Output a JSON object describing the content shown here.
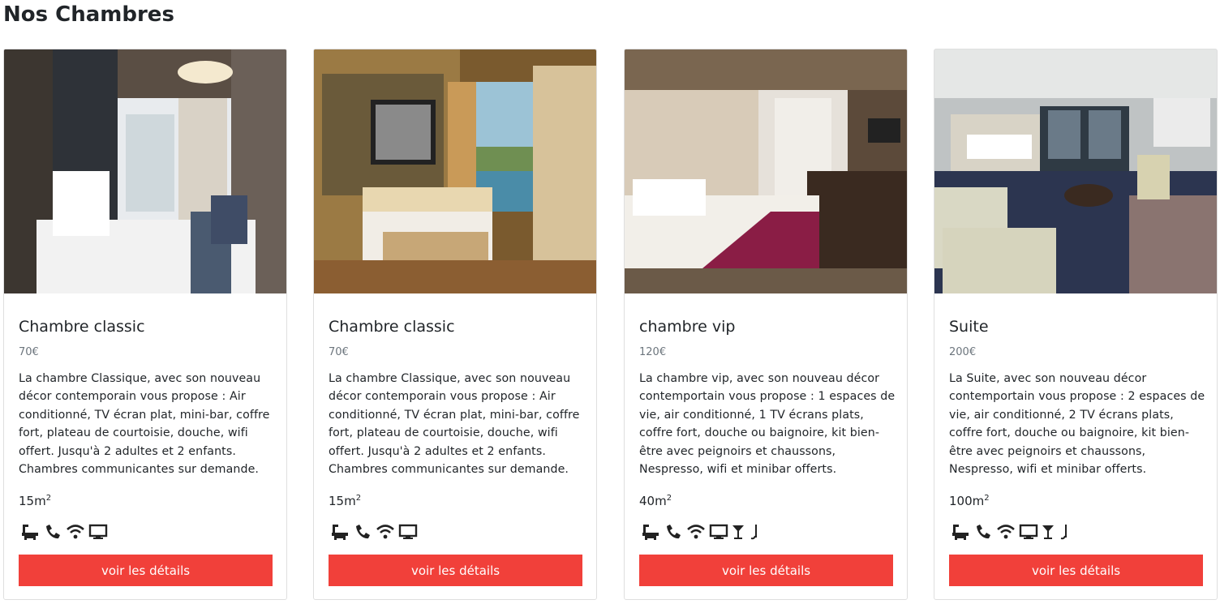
{
  "page_title": "Nos Chambres",
  "colors": {
    "button": "#f1403a",
    "price": "#6c757d",
    "text": "#212529"
  },
  "rooms": [
    {
      "title": "Chambre classic",
      "price": "70€",
      "description": "La chambre Classique, avec son nouveau décor contemporain vous propose : Air conditionné, TV écran plat, mini-bar, coffre fort, plateau de courtoisie, douche, wifi offert. Jusqu'à 2 adultes et 2 enfants. Chambres communicantes sur demande.",
      "area_value": "15m",
      "area_exp": "2",
      "amenities": [
        "bathtub-icon",
        "phone-icon",
        "wifi-icon",
        "tv-icon"
      ],
      "button": "voir les détails"
    },
    {
      "title": "Chambre classic",
      "price": "70€",
      "description": "La chambre Classique, avec son nouveau décor contemporain vous propose : Air conditionné, TV écran plat, mini-bar, coffre fort, plateau de courtoisie, douche, wifi offert. Jusqu'à 2 adultes et 2 enfants. Chambres communicantes sur demande.",
      "area_value": "15m",
      "area_exp": "2",
      "amenities": [
        "bathtub-icon",
        "phone-icon",
        "wifi-icon",
        "tv-icon"
      ],
      "button": "voir les détails"
    },
    {
      "title": "chambre vip",
      "price": "120€",
      "description": "La chambre vip, avec son nouveau décor contemportain vous propose : 1 espaces de vie, air conditionné, 1 TV écrans plats, coffre fort, douche ou baignoire, kit bien-être avec peignoirs et chaussons, Nespresso, wifi et minibar offerts.",
      "area_value": "40m",
      "area_exp": "2",
      "amenities": [
        "bathtub-icon",
        "phone-icon",
        "wifi-icon",
        "tv-icon",
        "cocktail-icon",
        "music-note-icon"
      ],
      "button": "voir les détails"
    },
    {
      "title": "Suite",
      "price": "200€",
      "description": "La Suite, avec son nouveau décor contemportain vous propose : 2 espaces de vie, air conditionné, 2 TV écrans plats, coffre fort, douche ou baignoire, kit bien-être avec peignoirs et chaussons, Nespresso, wifi et minibar offerts.",
      "area_value": "100m",
      "area_exp": "2",
      "amenities": [
        "bathtub-icon",
        "phone-icon",
        "wifi-icon",
        "tv-icon",
        "cocktail-icon",
        "music-note-icon"
      ],
      "button": "voir les détails"
    }
  ]
}
